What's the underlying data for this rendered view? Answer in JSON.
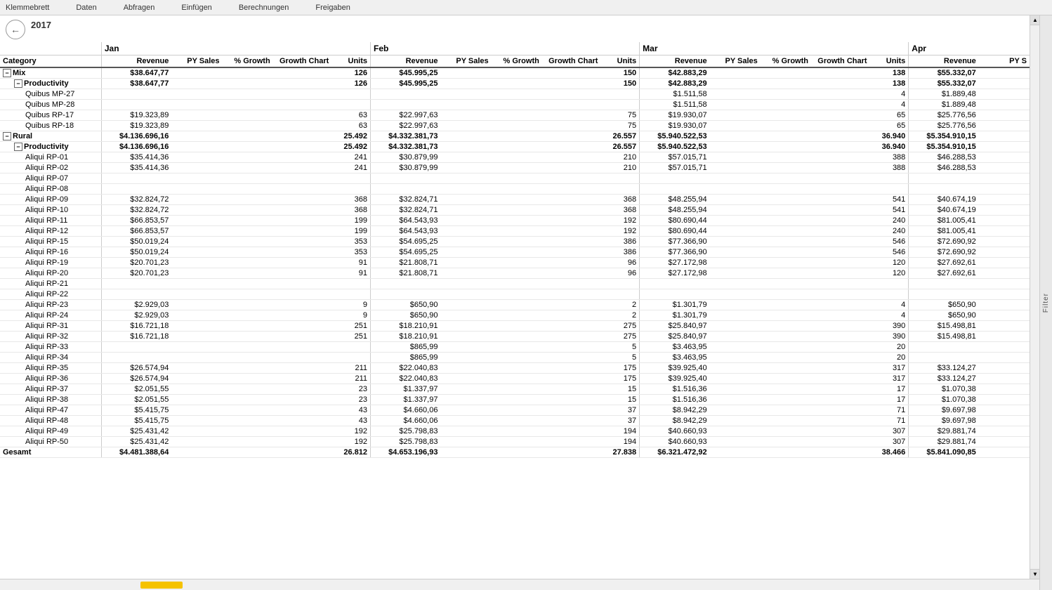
{
  "menubar": {
    "items": [
      "Klemmebrett",
      "Daten",
      "Abfragen",
      "Einfügen",
      "Berechnungen",
      "Freigaben"
    ]
  },
  "toolbar": {
    "year": "2017",
    "back_icon": "←"
  },
  "filter": {
    "label": "Filter"
  },
  "headers": {
    "months": [
      "Jan",
      "Feb",
      "Mar",
      "Apr"
    ],
    "cols": [
      "Category",
      "Revenue",
      "PY Sales",
      "% Growth",
      "Growth Chart",
      "Units",
      "Revenue",
      "PY Sales",
      "% Growth",
      "Growth Chart",
      "Units",
      "Revenue",
      "PY Sales",
      "% Growth",
      "Growth Chart",
      "Units",
      "Revenue",
      "PY S"
    ]
  },
  "rows": [
    {
      "type": "category",
      "expandable": true,
      "expanded": true,
      "indent": 0,
      "name": "Mix",
      "jan_rev": "$38.647,77",
      "jan_pys": "",
      "jan_growth": "",
      "jan_chart": "",
      "jan_units": "126",
      "feb_rev": "$45.995,25",
      "feb_pys": "",
      "feb_growth": "",
      "feb_chart": "",
      "feb_units": "150",
      "mar_rev": "$42.883,29",
      "mar_pys": "",
      "mar_growth": "",
      "mar_chart": "",
      "mar_units": "138",
      "apr_rev": "$55.332,07",
      "apr_pys": ""
    },
    {
      "type": "subcategory",
      "expandable": true,
      "expanded": true,
      "indent": 1,
      "name": "Productivity",
      "jan_rev": "$38.647,77",
      "jan_pys": "",
      "jan_growth": "",
      "jan_chart": "",
      "jan_units": "126",
      "feb_rev": "$45.995,25",
      "feb_pys": "",
      "feb_growth": "",
      "feb_chart": "",
      "feb_units": "150",
      "mar_rev": "$42.883,29",
      "mar_pys": "",
      "mar_growth": "",
      "mar_chart": "",
      "mar_units": "138",
      "apr_rev": "$55.332,07",
      "apr_pys": ""
    },
    {
      "type": "item",
      "indent": 2,
      "name": "Quibus MP-27",
      "jan_rev": "",
      "jan_pys": "",
      "jan_growth": "",
      "jan_chart": "",
      "jan_units": "",
      "feb_rev": "",
      "feb_pys": "",
      "feb_growth": "",
      "feb_chart": "",
      "feb_units": "",
      "mar_rev": "$1.511,58",
      "mar_pys": "",
      "mar_growth": "",
      "mar_chart": "",
      "mar_units": "4",
      "apr_rev": "$1.889,48",
      "apr_pys": ""
    },
    {
      "type": "item",
      "indent": 2,
      "name": "Quibus MP-28",
      "jan_rev": "",
      "jan_pys": "",
      "jan_growth": "",
      "jan_chart": "",
      "jan_units": "",
      "feb_rev": "",
      "feb_pys": "",
      "feb_growth": "",
      "feb_chart": "",
      "feb_units": "",
      "mar_rev": "$1.511,58",
      "mar_pys": "",
      "mar_growth": "",
      "mar_chart": "",
      "mar_units": "4",
      "apr_rev": "$1.889,48",
      "apr_pys": ""
    },
    {
      "type": "item",
      "indent": 2,
      "name": "Quibus RP-17",
      "jan_rev": "$19.323,89",
      "jan_pys": "",
      "jan_growth": "",
      "jan_chart": "",
      "jan_units": "63",
      "feb_rev": "$22.997,63",
      "feb_pys": "",
      "feb_growth": "",
      "feb_chart": "",
      "feb_units": "75",
      "mar_rev": "$19.930,07",
      "mar_pys": "",
      "mar_growth": "",
      "mar_chart": "",
      "mar_units": "65",
      "apr_rev": "$25.776,56",
      "apr_pys": ""
    },
    {
      "type": "item",
      "indent": 2,
      "name": "Quibus RP-18",
      "jan_rev": "$19.323,89",
      "jan_pys": "",
      "jan_growth": "",
      "jan_chart": "",
      "jan_units": "63",
      "feb_rev": "$22.997,63",
      "feb_pys": "",
      "feb_growth": "",
      "feb_chart": "",
      "feb_units": "75",
      "mar_rev": "$19.930,07",
      "mar_pys": "",
      "mar_growth": "",
      "mar_chart": "",
      "mar_units": "65",
      "apr_rev": "$25.776,56",
      "apr_pys": ""
    },
    {
      "type": "category",
      "expandable": true,
      "expanded": true,
      "indent": 0,
      "name": "Rural",
      "jan_rev": "$4.136.696,16",
      "jan_pys": "",
      "jan_growth": "",
      "jan_chart": "",
      "jan_units": "25.492",
      "feb_rev": "$4.332.381,73",
      "feb_pys": "",
      "feb_growth": "",
      "feb_chart": "",
      "feb_units": "26.557",
      "mar_rev": "$5.940.522,53",
      "mar_pys": "",
      "mar_growth": "",
      "mar_chart": "",
      "mar_units": "36.940",
      "apr_rev": "$5.354.910,15",
      "apr_pys": ""
    },
    {
      "type": "subcategory",
      "expandable": true,
      "expanded": true,
      "indent": 1,
      "name": "Productivity",
      "jan_rev": "$4.136.696,16",
      "jan_pys": "",
      "jan_growth": "",
      "jan_chart": "",
      "jan_units": "25.492",
      "feb_rev": "$4.332.381,73",
      "feb_pys": "",
      "feb_growth": "",
      "feb_chart": "",
      "feb_units": "26.557",
      "mar_rev": "$5.940.522,53",
      "mar_pys": "",
      "mar_growth": "",
      "mar_chart": "",
      "mar_units": "36.940",
      "apr_rev": "$5.354.910,15",
      "apr_pys": ""
    },
    {
      "type": "item",
      "indent": 2,
      "name": "Aliqui RP-01",
      "jan_rev": "$35.414,36",
      "jan_pys": "",
      "jan_growth": "",
      "jan_chart": "",
      "jan_units": "241",
      "feb_rev": "$30.879,99",
      "feb_pys": "",
      "feb_growth": "",
      "feb_chart": "",
      "feb_units": "210",
      "mar_rev": "$57.015,71",
      "mar_pys": "",
      "mar_growth": "",
      "mar_chart": "",
      "mar_units": "388",
      "apr_rev": "$46.288,53",
      "apr_pys": ""
    },
    {
      "type": "item",
      "indent": 2,
      "name": "Aliqui RP-02",
      "jan_rev": "$35.414,36",
      "jan_pys": "",
      "jan_growth": "",
      "jan_chart": "",
      "jan_units": "241",
      "feb_rev": "$30.879,99",
      "feb_pys": "",
      "feb_growth": "",
      "feb_chart": "",
      "feb_units": "210",
      "mar_rev": "$57.015,71",
      "mar_pys": "",
      "mar_growth": "",
      "mar_chart": "",
      "mar_units": "388",
      "apr_rev": "$46.288,53",
      "apr_pys": ""
    },
    {
      "type": "item",
      "indent": 2,
      "name": "Aliqui RP-07",
      "jan_rev": "",
      "jan_pys": "",
      "jan_growth": "",
      "jan_chart": "",
      "jan_units": "",
      "feb_rev": "",
      "feb_pys": "",
      "feb_growth": "",
      "feb_chart": "",
      "feb_units": "",
      "mar_rev": "",
      "mar_pys": "",
      "mar_growth": "",
      "mar_chart": "",
      "mar_units": "",
      "apr_rev": "",
      "apr_pys": ""
    },
    {
      "type": "item",
      "indent": 2,
      "name": "Aliqui RP-08",
      "jan_rev": "",
      "jan_pys": "",
      "jan_growth": "",
      "jan_chart": "",
      "jan_units": "",
      "feb_rev": "",
      "feb_pys": "",
      "feb_growth": "",
      "feb_chart": "",
      "feb_units": "",
      "mar_rev": "",
      "mar_pys": "",
      "mar_growth": "",
      "mar_chart": "",
      "mar_units": "",
      "apr_rev": "",
      "apr_pys": ""
    },
    {
      "type": "item",
      "indent": 2,
      "name": "Aliqui RP-09",
      "jan_rev": "$32.824,72",
      "jan_pys": "",
      "jan_growth": "",
      "jan_chart": "",
      "jan_units": "368",
      "feb_rev": "$32.824,71",
      "feb_pys": "",
      "feb_growth": "",
      "feb_chart": "",
      "feb_units": "368",
      "mar_rev": "$48.255,94",
      "mar_pys": "",
      "mar_growth": "",
      "mar_chart": "",
      "mar_units": "541",
      "apr_rev": "$40.674,19",
      "apr_pys": ""
    },
    {
      "type": "item",
      "indent": 2,
      "name": "Aliqui RP-10",
      "jan_rev": "$32.824,72",
      "jan_pys": "",
      "jan_growth": "",
      "jan_chart": "",
      "jan_units": "368",
      "feb_rev": "$32.824,71",
      "feb_pys": "",
      "feb_growth": "",
      "feb_chart": "",
      "feb_units": "368",
      "mar_rev": "$48.255,94",
      "mar_pys": "",
      "mar_growth": "",
      "mar_chart": "",
      "mar_units": "541",
      "apr_rev": "$40.674,19",
      "apr_pys": ""
    },
    {
      "type": "item",
      "indent": 2,
      "name": "Aliqui RP-11",
      "jan_rev": "$66.853,57",
      "jan_pys": "",
      "jan_growth": "",
      "jan_chart": "",
      "jan_units": "199",
      "feb_rev": "$64.543,93",
      "feb_pys": "",
      "feb_growth": "",
      "feb_chart": "",
      "feb_units": "192",
      "mar_rev": "$80.690,44",
      "mar_pys": "",
      "mar_growth": "",
      "mar_chart": "",
      "mar_units": "240",
      "apr_rev": "$81.005,41",
      "apr_pys": ""
    },
    {
      "type": "item",
      "indent": 2,
      "name": "Aliqui RP-12",
      "jan_rev": "$66.853,57",
      "jan_pys": "",
      "jan_growth": "",
      "jan_chart": "",
      "jan_units": "199",
      "feb_rev": "$64.543,93",
      "feb_pys": "",
      "feb_growth": "",
      "feb_chart": "",
      "feb_units": "192",
      "mar_rev": "$80.690,44",
      "mar_pys": "",
      "mar_growth": "",
      "mar_chart": "",
      "mar_units": "240",
      "apr_rev": "$81.005,41",
      "apr_pys": ""
    },
    {
      "type": "item",
      "indent": 2,
      "name": "Aliqui RP-15",
      "jan_rev": "$50.019,24",
      "jan_pys": "",
      "jan_growth": "",
      "jan_chart": "",
      "jan_units": "353",
      "feb_rev": "$54.695,25",
      "feb_pys": "",
      "feb_growth": "",
      "feb_chart": "",
      "feb_units": "386",
      "mar_rev": "$77.366,90",
      "mar_pys": "",
      "mar_growth": "",
      "mar_chart": "",
      "mar_units": "546",
      "apr_rev": "$72.690,92",
      "apr_pys": ""
    },
    {
      "type": "item",
      "indent": 2,
      "name": "Aliqui RP-16",
      "jan_rev": "$50.019,24",
      "jan_pys": "",
      "jan_growth": "",
      "jan_chart": "",
      "jan_units": "353",
      "feb_rev": "$54.695,25",
      "feb_pys": "",
      "feb_growth": "",
      "feb_chart": "",
      "feb_units": "386",
      "mar_rev": "$77.366,90",
      "mar_pys": "",
      "mar_growth": "",
      "mar_chart": "",
      "mar_units": "546",
      "apr_rev": "$72.690,92",
      "apr_pys": ""
    },
    {
      "type": "item",
      "indent": 2,
      "name": "Aliqui RP-19",
      "jan_rev": "$20.701,23",
      "jan_pys": "",
      "jan_growth": "",
      "jan_chart": "",
      "jan_units": "91",
      "feb_rev": "$21.808,71",
      "feb_pys": "",
      "feb_growth": "",
      "feb_chart": "",
      "feb_units": "96",
      "mar_rev": "$27.172,98",
      "mar_pys": "",
      "mar_growth": "",
      "mar_chart": "",
      "mar_units": "120",
      "apr_rev": "$27.692,61",
      "apr_pys": ""
    },
    {
      "type": "item",
      "indent": 2,
      "name": "Aliqui RP-20",
      "jan_rev": "$20.701,23",
      "jan_pys": "",
      "jan_growth": "",
      "jan_chart": "",
      "jan_units": "91",
      "feb_rev": "$21.808,71",
      "feb_pys": "",
      "feb_growth": "",
      "feb_chart": "",
      "feb_units": "96",
      "mar_rev": "$27.172,98",
      "mar_pys": "",
      "mar_growth": "",
      "mar_chart": "",
      "mar_units": "120",
      "apr_rev": "$27.692,61",
      "apr_pys": ""
    },
    {
      "type": "item",
      "indent": 2,
      "name": "Aliqui RP-21",
      "jan_rev": "",
      "jan_pys": "",
      "jan_growth": "",
      "jan_chart": "",
      "jan_units": "",
      "feb_rev": "",
      "feb_pys": "",
      "feb_growth": "",
      "feb_chart": "",
      "feb_units": "",
      "mar_rev": "",
      "mar_pys": "",
      "mar_growth": "",
      "mar_chart": "",
      "mar_units": "",
      "apr_rev": "",
      "apr_pys": ""
    },
    {
      "type": "item",
      "indent": 2,
      "name": "Aliqui RP-22",
      "jan_rev": "",
      "jan_pys": "",
      "jan_growth": "",
      "jan_chart": "",
      "jan_units": "",
      "feb_rev": "",
      "feb_pys": "",
      "feb_growth": "",
      "feb_chart": "",
      "feb_units": "",
      "mar_rev": "",
      "mar_pys": "",
      "mar_growth": "",
      "mar_chart": "",
      "mar_units": "",
      "apr_rev": "",
      "apr_pys": ""
    },
    {
      "type": "item",
      "indent": 2,
      "name": "Aliqui RP-23",
      "jan_rev": "$2.929,03",
      "jan_pys": "",
      "jan_growth": "",
      "jan_chart": "",
      "jan_units": "9",
      "feb_rev": "$650,90",
      "feb_pys": "",
      "feb_growth": "",
      "feb_chart": "",
      "feb_units": "2",
      "mar_rev": "$1.301,79",
      "mar_pys": "",
      "mar_growth": "",
      "mar_chart": "",
      "mar_units": "4",
      "apr_rev": "$650,90",
      "apr_pys": ""
    },
    {
      "type": "item",
      "indent": 2,
      "name": "Aliqui RP-24",
      "jan_rev": "$2.929,03",
      "jan_pys": "",
      "jan_growth": "",
      "jan_chart": "",
      "jan_units": "9",
      "feb_rev": "$650,90",
      "feb_pys": "",
      "feb_growth": "",
      "feb_chart": "",
      "feb_units": "2",
      "mar_rev": "$1.301,79",
      "mar_pys": "",
      "mar_growth": "",
      "mar_chart": "",
      "mar_units": "4",
      "apr_rev": "$650,90",
      "apr_pys": ""
    },
    {
      "type": "item",
      "indent": 2,
      "name": "Aliqui RP-31",
      "jan_rev": "$16.721,18",
      "jan_pys": "",
      "jan_growth": "",
      "jan_chart": "",
      "jan_units": "251",
      "feb_rev": "$18.210,91",
      "feb_pys": "",
      "feb_growth": "",
      "feb_chart": "",
      "feb_units": "275",
      "mar_rev": "$25.840,97",
      "mar_pys": "",
      "mar_growth": "",
      "mar_chart": "",
      "mar_units": "390",
      "apr_rev": "$15.498,81",
      "apr_pys": ""
    },
    {
      "type": "item",
      "indent": 2,
      "name": "Aliqui RP-32",
      "jan_rev": "$16.721,18",
      "jan_pys": "",
      "jan_growth": "",
      "jan_chart": "",
      "jan_units": "251",
      "feb_rev": "$18.210,91",
      "feb_pys": "",
      "feb_growth": "",
      "feb_chart": "",
      "feb_units": "275",
      "mar_rev": "$25.840,97",
      "mar_pys": "",
      "mar_growth": "",
      "mar_chart": "",
      "mar_units": "390",
      "apr_rev": "$15.498,81",
      "apr_pys": ""
    },
    {
      "type": "item",
      "indent": 2,
      "name": "Aliqui RP-33",
      "jan_rev": "",
      "jan_pys": "",
      "jan_growth": "",
      "jan_chart": "",
      "jan_units": "",
      "feb_rev": "$865,99",
      "feb_pys": "",
      "feb_growth": "",
      "feb_chart": "",
      "feb_units": "5",
      "mar_rev": "$3.463,95",
      "mar_pys": "",
      "mar_growth": "",
      "mar_chart": "",
      "mar_units": "20",
      "apr_rev": "",
      "apr_pys": ""
    },
    {
      "type": "item",
      "indent": 2,
      "name": "Aliqui RP-34",
      "jan_rev": "",
      "jan_pys": "",
      "jan_growth": "",
      "jan_chart": "",
      "jan_units": "",
      "feb_rev": "$865,99",
      "feb_pys": "",
      "feb_growth": "",
      "feb_chart": "",
      "feb_units": "5",
      "mar_rev": "$3.463,95",
      "mar_pys": "",
      "mar_growth": "",
      "mar_chart": "",
      "mar_units": "20",
      "apr_rev": "",
      "apr_pys": ""
    },
    {
      "type": "item",
      "indent": 2,
      "name": "Aliqui RP-35",
      "jan_rev": "$26.574,94",
      "jan_pys": "",
      "jan_growth": "",
      "jan_chart": "",
      "jan_units": "211",
      "feb_rev": "$22.040,83",
      "feb_pys": "",
      "feb_growth": "",
      "feb_chart": "",
      "feb_units": "175",
      "mar_rev": "$39.925,40",
      "mar_pys": "",
      "mar_growth": "",
      "mar_chart": "",
      "mar_units": "317",
      "apr_rev": "$33.124,27",
      "apr_pys": ""
    },
    {
      "type": "item",
      "indent": 2,
      "name": "Aliqui RP-36",
      "jan_rev": "$26.574,94",
      "jan_pys": "",
      "jan_growth": "",
      "jan_chart": "",
      "jan_units": "211",
      "feb_rev": "$22.040,83",
      "feb_pys": "",
      "feb_growth": "",
      "feb_chart": "",
      "feb_units": "175",
      "mar_rev": "$39.925,40",
      "mar_pys": "",
      "mar_growth": "",
      "mar_chart": "",
      "mar_units": "317",
      "apr_rev": "$33.124,27",
      "apr_pys": ""
    },
    {
      "type": "item",
      "indent": 2,
      "name": "Aliqui RP-37",
      "jan_rev": "$2.051,55",
      "jan_pys": "",
      "jan_growth": "",
      "jan_chart": "",
      "jan_units": "23",
      "feb_rev": "$1.337,97",
      "feb_pys": "",
      "feb_growth": "",
      "feb_chart": "",
      "feb_units": "15",
      "mar_rev": "$1.516,36",
      "mar_pys": "",
      "mar_growth": "",
      "mar_chart": "",
      "mar_units": "17",
      "apr_rev": "$1.070,38",
      "apr_pys": ""
    },
    {
      "type": "item",
      "indent": 2,
      "name": "Aliqui RP-38",
      "jan_rev": "$2.051,55",
      "jan_pys": "",
      "jan_growth": "",
      "jan_chart": "",
      "jan_units": "23",
      "feb_rev": "$1.337,97",
      "feb_pys": "",
      "feb_growth": "",
      "feb_chart": "",
      "feb_units": "15",
      "mar_rev": "$1.516,36",
      "mar_pys": "",
      "mar_growth": "",
      "mar_chart": "",
      "mar_units": "17",
      "apr_rev": "$1.070,38",
      "apr_pys": ""
    },
    {
      "type": "item",
      "indent": 2,
      "name": "Aliqui RP-47",
      "jan_rev": "$5.415,75",
      "jan_pys": "",
      "jan_growth": "",
      "jan_chart": "",
      "jan_units": "43",
      "feb_rev": "$4.660,06",
      "feb_pys": "",
      "feb_growth": "",
      "feb_chart": "",
      "feb_units": "37",
      "mar_rev": "$8.942,29",
      "mar_pys": "",
      "mar_growth": "",
      "mar_chart": "",
      "mar_units": "71",
      "apr_rev": "$9.697,98",
      "apr_pys": ""
    },
    {
      "type": "item",
      "indent": 2,
      "name": "Aliqui RP-48",
      "jan_rev": "$5.415,75",
      "jan_pys": "",
      "jan_growth": "",
      "jan_chart": "",
      "jan_units": "43",
      "feb_rev": "$4.660,06",
      "feb_pys": "",
      "feb_growth": "",
      "feb_chart": "",
      "feb_units": "37",
      "mar_rev": "$8.942,29",
      "mar_pys": "",
      "mar_growth": "",
      "mar_chart": "",
      "mar_units": "71",
      "apr_rev": "$9.697,98",
      "apr_pys": ""
    },
    {
      "type": "item",
      "indent": 2,
      "name": "Aliqui RP-49",
      "jan_rev": "$25.431,42",
      "jan_pys": "",
      "jan_growth": "",
      "jan_chart": "",
      "jan_units": "192",
      "feb_rev": "$25.798,83",
      "feb_pys": "",
      "feb_growth": "",
      "feb_chart": "",
      "feb_units": "194",
      "mar_rev": "$40.660,93",
      "mar_pys": "",
      "mar_growth": "",
      "mar_chart": "",
      "mar_units": "307",
      "apr_rev": "$29.881,74",
      "apr_pys": ""
    },
    {
      "type": "item",
      "indent": 2,
      "name": "Aliqui RP-50",
      "jan_rev": "$25.431,42",
      "jan_pys": "",
      "jan_growth": "",
      "jan_chart": "",
      "jan_units": "192",
      "feb_rev": "$25.798,83",
      "feb_pys": "",
      "feb_growth": "",
      "feb_chart": "",
      "feb_units": "194",
      "mar_rev": "$40.660,93",
      "mar_pys": "",
      "mar_growth": "",
      "mar_chart": "",
      "mar_units": "307",
      "apr_rev": "$29.881,74",
      "apr_pys": ""
    },
    {
      "type": "total",
      "indent": 0,
      "name": "Gesamt",
      "jan_rev": "$4.481.388,64",
      "jan_pys": "",
      "jan_growth": "",
      "jan_chart": "",
      "jan_units": "26.812",
      "feb_rev": "$4.653.196,93",
      "feb_pys": "",
      "feb_growth": "",
      "feb_chart": "",
      "feb_units": "27.838",
      "mar_rev": "$6.321.472,92",
      "mar_pys": "",
      "mar_growth": "",
      "mar_chart": "",
      "mar_units": "38.466",
      "apr_rev": "$5.841.090,85",
      "apr_pys": ""
    }
  ]
}
